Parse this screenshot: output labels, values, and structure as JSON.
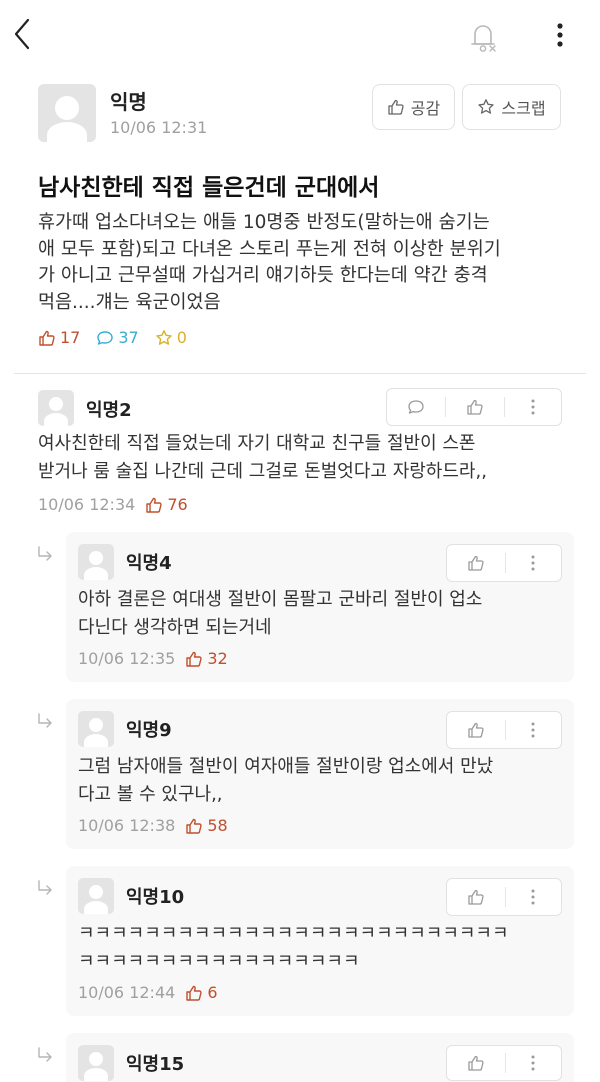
{
  "topbar": {
    "back_icon": "chevron-left-icon",
    "bell_icon": "bell-off-icon",
    "more_icon": "more-vertical-icon"
  },
  "post": {
    "author": "익명",
    "time": "10/06 12:31",
    "like_button": "공감",
    "scrap_button": "스크랩",
    "title": "남사친한테 직접 들은건데 군대에서",
    "body_lines": [
      "휴가때 업소다녀오는 애들 10명중 반정도(말하는애 숨기는",
      "애 모두 포함)되고 다녀온 스토리 푸는게 전혀 이상한 분위기",
      "가 아니고 근무설때 가십거리 얘기하듯 한다는데 약간 충격",
      "먹음....걔는 육군이었음"
    ],
    "stats": {
      "likes": "17",
      "comments": "37",
      "scraps": "0"
    }
  },
  "comments": [
    {
      "author": "익명2",
      "lines": [
        "여사친한테 직접 들었는데 자기 대학교 친구들 절반이 스폰",
        "받거나 룸 술집 나간데 근데 그걸로 돈벌엇다고 자랑하드라,,"
      ],
      "time": "10/06 12:34",
      "likes": "76"
    }
  ],
  "replies": [
    {
      "author": "익명4",
      "lines": [
        "아하 결론은 여대생 절반이 몸팔고 군바리 절반이 업소",
        "다닌다 생각하면 되는거네"
      ],
      "time": "10/06 12:35",
      "likes": "32"
    },
    {
      "author": "익명9",
      "lines": [
        "그럼 남자애들 절반이 여자애들 절반이랑 업소에서 만났",
        "다고 볼 수 있구나,,"
      ],
      "time": "10/06 12:38",
      "likes": "58"
    },
    {
      "author": "익명10",
      "lines": [
        "ㅋㅋㅋㅋㅋㅋㅋㅋㅋㅋㅋㅋㅋㅋㅋㅋㅋㅋㅋㅋㅋㅋㅋㅋㅋㅋ",
        "ㅋㅋㅋㅋㅋㅋㅋㅋㅋㅋㅋㅋㅋㅋㅋㅋㅋ"
      ],
      "time": "10/06 12:44",
      "likes": "6"
    },
    {
      "author": "익명15",
      "lines": [],
      "time": "",
      "likes": ""
    }
  ],
  "colors": {
    "like": "#c0502d",
    "comment": "#3aaecf",
    "scrap": "#d9b12a",
    "meta": "#a0a0a0"
  }
}
